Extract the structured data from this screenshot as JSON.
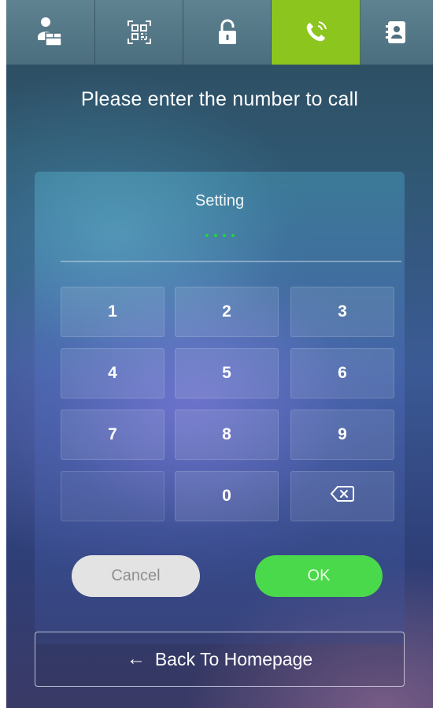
{
  "tabs": [
    {
      "icon": "delivery-person-icon"
    },
    {
      "icon": "qr-code-icon"
    },
    {
      "icon": "unlock-icon"
    },
    {
      "icon": "phone-call-icon",
      "active": true
    },
    {
      "icon": "contacts-icon"
    }
  ],
  "prompt": "Please enter the number to call",
  "panel": {
    "title": "Setting",
    "input_dots": 4
  },
  "keypad": {
    "keys": [
      "1",
      "2",
      "3",
      "4",
      "5",
      "6",
      "7",
      "8",
      "9",
      "",
      "0"
    ],
    "backspace_icon": "backspace-icon"
  },
  "buttons": {
    "cancel": "Cancel",
    "ok": "OK"
  },
  "back": {
    "arrow": "←",
    "label": "Back To Homepage"
  },
  "colors": {
    "active_tab": "#8cc51e",
    "ok_button": "#4ad94a",
    "cancel_button": "#e3e3e3",
    "input_dots": "#22d63a"
  }
}
